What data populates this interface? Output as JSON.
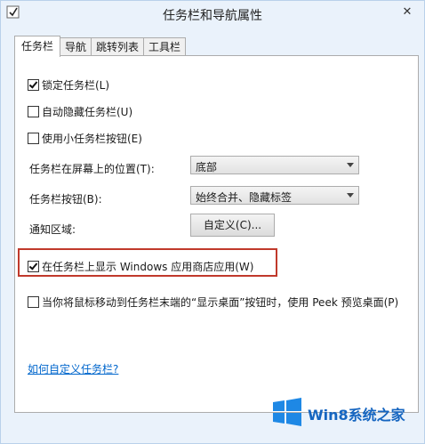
{
  "window": {
    "title": "任务栏和导航属性",
    "close_glyph": "✕"
  },
  "tabs": [
    {
      "label": "任务栏",
      "active": true
    },
    {
      "label": "导航",
      "active": false
    },
    {
      "label": "跳转列表",
      "active": false
    },
    {
      "label": "工具栏",
      "active": false
    }
  ],
  "options": {
    "lock_taskbar": {
      "label": "锁定任务栏(L)",
      "checked": true
    },
    "autohide": {
      "label": "自动隐藏任务栏(U)",
      "checked": false
    },
    "small_buttons": {
      "label": "使用小任务栏按钮(E)",
      "checked": false
    },
    "show_store_apps": {
      "label": "在任务栏上显示 Windows 应用商店应用(W)",
      "checked": true
    },
    "peek": {
      "label": "当你将鼠标移动到任务栏末端的“显示桌面”按钮时，使用 Peek 预览桌面(P)",
      "checked": false
    }
  },
  "position": {
    "label": "任务栏在屏幕上的位置(T):",
    "value": "底部"
  },
  "buttons": {
    "label": "任务栏按钮(B):",
    "value": "始终合并、隐藏标签"
  },
  "notify": {
    "label": "通知区域:",
    "button": "自定义(C)..."
  },
  "help_link": "如何自定义任务栏?",
  "watermark": {
    "text": "Win8系统之家",
    "color": "#1565c0"
  },
  "colors": {
    "accent_border": "#c0392b",
    "link": "#0066cc"
  }
}
